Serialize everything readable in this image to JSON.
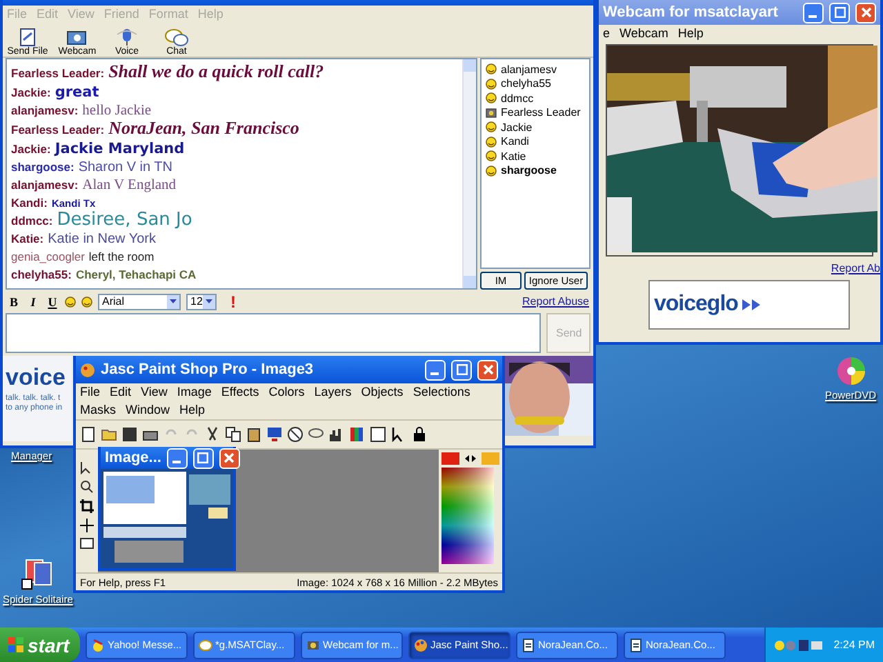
{
  "chat_window": {
    "menu": [
      "File",
      "Edit",
      "View",
      "Friend",
      "Format",
      "Help"
    ],
    "toolbar": [
      {
        "label": "Send File",
        "kind": "file"
      },
      {
        "label": "Webcam",
        "kind": "webcam"
      },
      {
        "label": "Voice",
        "kind": "voice"
      },
      {
        "label": "Chat",
        "kind": "chat"
      }
    ],
    "messages": [
      {
        "sender": {
          "text": "Fearless Leader:",
          "color": "#7a1030"
        },
        "message": {
          "text": "Shall we do a quick roll call?",
          "color": "#6a0c3c"
        },
        "kind": "script"
      },
      {
        "sender": {
          "text": "Jackie:",
          "color": "#7a1030"
        },
        "message": {
          "text": "great",
          "color": "#1a1ab0"
        },
        "kind": "comic"
      },
      {
        "sender": {
          "text": "alanjamesv:",
          "color": "#7a1030"
        },
        "message": {
          "text": "hello Jackie",
          "color": "#7a4a8a"
        },
        "kind": "serif"
      },
      {
        "sender": {
          "text": "Fearless Leader:",
          "color": "#7a1030"
        },
        "message": {
          "text": "NoraJean, San Francisco",
          "color": "#6a0c3c"
        },
        "kind": "script"
      },
      {
        "sender": {
          "text": "Jackie:",
          "color": "#7a1030"
        },
        "message": {
          "text": "Jackie Maryland",
          "color": "#1a1a90"
        },
        "kind": "comic"
      },
      {
        "sender": {
          "text": "shargoose:",
          "color": "#2a2ab0"
        },
        "message": {
          "text": "Sharon V in TN",
          "color": "#4a4ab0"
        },
        "kind": "sans"
      },
      {
        "sender": {
          "text": "alanjamesv:",
          "color": "#7a1030"
        },
        "message": {
          "text": "Alan V England",
          "color": "#7a4a8a"
        },
        "kind": "serif"
      },
      {
        "sender": {
          "text": "Kandi:",
          "color": "#7a1030"
        },
        "message": {
          "text": "Kandi Tx",
          "color": "#1a1a9a"
        },
        "kind": "tiny"
      },
      {
        "sender": {
          "text": "ddmcc:",
          "color": "#7a1030"
        },
        "message": {
          "text": "Desiree, San Jo",
          "color": "#2a8a9a"
        },
        "kind": "large"
      },
      {
        "sender": {
          "text": "Katie:",
          "color": "#7a1030"
        },
        "message": {
          "text": "Katie in New York",
          "color": "#4a4a9a"
        },
        "kind": "sans"
      },
      {
        "sender": {
          "text": "genia_coogler",
          "color": "#a05060"
        },
        "message": {
          "text": "left the room",
          "color": "#222222"
        },
        "kind": "event"
      },
      {
        "sender": {
          "text": "chelyha55:",
          "color": "#7a1030"
        },
        "message": {
          "text": "Cheryl, Tehachapi CA",
          "color": "#5a6a30"
        },
        "kind": "bold"
      }
    ],
    "users": [
      {
        "name": "alanjamesv",
        "kind": "smiley",
        "bold": false
      },
      {
        "name": "chelyha55",
        "kind": "smiley",
        "bold": false
      },
      {
        "name": "ddmcc",
        "kind": "smiley",
        "bold": false
      },
      {
        "name": "Fearless Leader",
        "kind": "webcam",
        "bold": false
      },
      {
        "name": "Jackie",
        "kind": "smiley",
        "bold": false
      },
      {
        "name": "Kandi",
        "kind": "smiley",
        "bold": false
      },
      {
        "name": "Katie",
        "kind": "smiley",
        "bold": false
      },
      {
        "name": "shargoose",
        "kind": "smiley",
        "bold": true
      }
    ],
    "user_buttons": [
      "IM",
      "Ignore User"
    ],
    "format_bar": {
      "bold": "B",
      "italic": "I",
      "underline": "U",
      "font": "Arial",
      "size": "12",
      "alert": "!",
      "report": "Report Abuse"
    },
    "send_button": "Send",
    "ad": {
      "logo": "voice",
      "lines": [
        "talk. talk. talk. t",
        "to any phone in"
      ]
    }
  },
  "webcam_window": {
    "title": "Webcam for msatclayart",
    "menu": [
      "e",
      "Webcam",
      "Help"
    ],
    "report": "Report Ab",
    "ad_logo": "voiceglo"
  },
  "paint_window": {
    "title": "Jasc Paint Shop Pro - Image3",
    "menu": [
      "File",
      "Edit",
      "View",
      "Image",
      "Effects",
      "Colors",
      "Layers",
      "Objects",
      "Selections",
      "Masks",
      "Window",
      "Help"
    ],
    "image_window": {
      "title": "Image..."
    },
    "status": "For Help, press F1",
    "image_info": "Image:  1024 x 768 x 16 Million - 2.2 MBytes"
  },
  "desktop_icons": [
    {
      "label": "PowerDVD",
      "kind": "dvd"
    },
    {
      "label": "Manager",
      "kind": "covered"
    },
    {
      "label": "Spider Solitaire",
      "kind": "cards"
    }
  ],
  "taskbar": {
    "start": "start",
    "items": [
      {
        "label": "Yahoo! Messe...",
        "kind": "yahoo",
        "selected": false
      },
      {
        "label": "*g.MSATClay...",
        "kind": "chat",
        "selected": false
      },
      {
        "label": "Webcam for m...",
        "kind": "webcam",
        "selected": false
      },
      {
        "label": "Jasc Paint Sho...",
        "kind": "paint",
        "selected": true
      },
      {
        "label": "NoraJean.Co...",
        "kind": "doc",
        "selected": false
      },
      {
        "label": "NoraJean.Co...",
        "kind": "doc",
        "selected": false
      }
    ],
    "clock": "2:24 PM"
  }
}
